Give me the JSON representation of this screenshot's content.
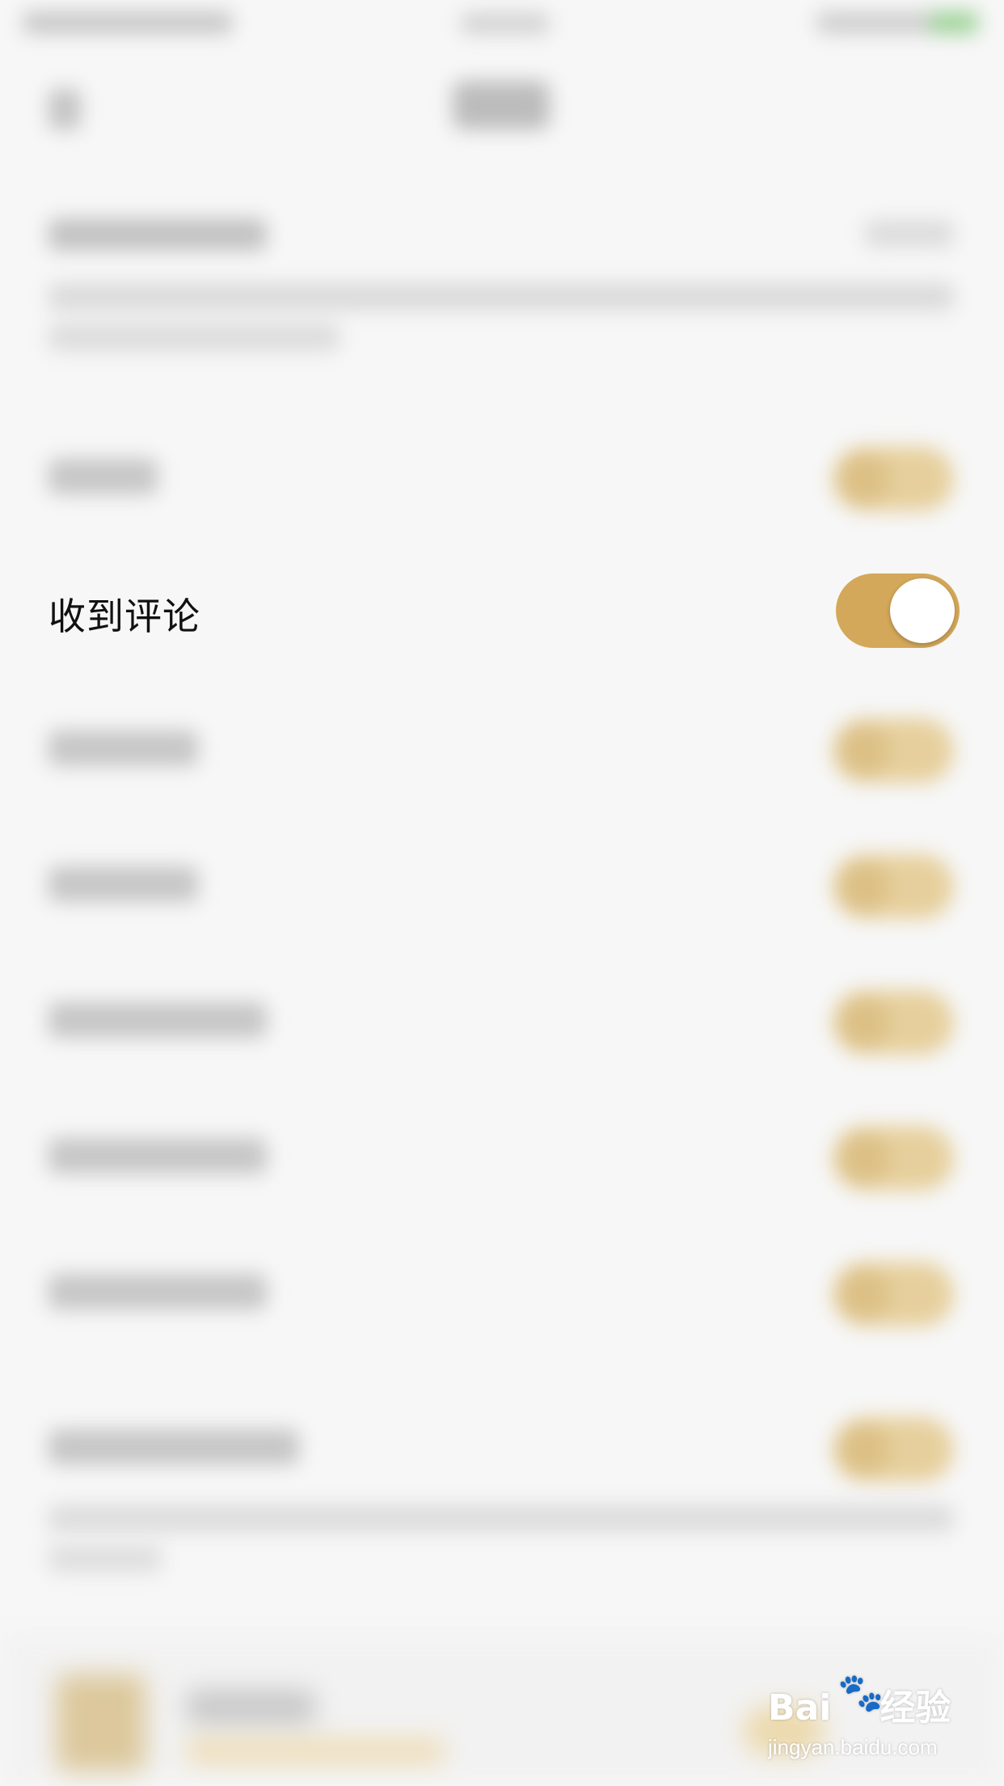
{
  "settings": {
    "focused_item": {
      "label": "收到评论",
      "toggle_on": true
    }
  },
  "colors": {
    "background": "#f7f7f7",
    "toggle_on": "#d4a85a",
    "knob": "#ffffff",
    "text": "#111111"
  },
  "watermark": {
    "logo_text": "Bai",
    "logo_text_2": "经验",
    "site": "jingyan.baidu.com",
    "paw_icon": "paw-icon"
  }
}
